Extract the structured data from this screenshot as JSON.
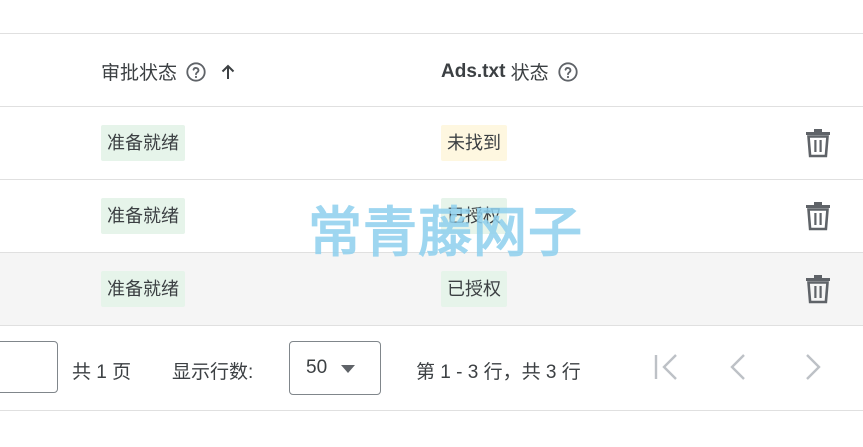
{
  "table": {
    "headers": {
      "approval_status": "审批状态",
      "ads_txt_bold": "Ads.txt",
      "ads_txt_suffix": " 状态"
    },
    "rows": [
      {
        "approval": "准备就绪",
        "ads_txt": "未找到",
        "ads_txt_status": "warning"
      },
      {
        "approval": "准备就绪",
        "ads_txt": "已授权",
        "ads_txt_status": "ok"
      },
      {
        "approval": "准备就绪",
        "ads_txt": "已授权",
        "ads_txt_status": "ok"
      }
    ]
  },
  "pagination": {
    "page_input_value": "",
    "total_pages_label": "共 1 页",
    "rows_per_page_label": "显示行数:",
    "rows_per_page_value": "50",
    "range_label": "第 1 - 3 行，共 3 行"
  },
  "watermark": "常青藤网子",
  "colors": {
    "chip_green": "#e6f4ea",
    "chip_yellow": "#fef7e0",
    "icon_gray": "#5f6368",
    "disabled_gray": "#bdc1c6",
    "watermark": "#8ed0ee"
  }
}
